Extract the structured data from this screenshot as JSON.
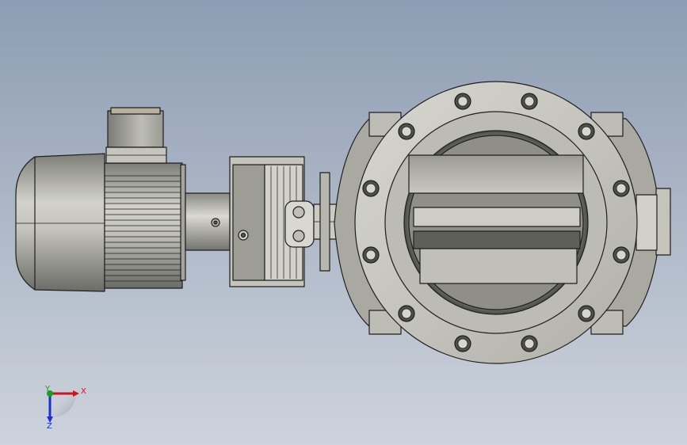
{
  "viewport": {
    "background_top": "#8e9db3",
    "background_bottom": "#cdd3dc",
    "model_name": "rotary-valve-with-gear-motor"
  },
  "colors": {
    "metal_light": "#c9c9c2",
    "metal_mid": "#a9a9a1",
    "metal_dark": "#5a5a55",
    "edge": "#1e1e1e",
    "axis_x": "#d0141e",
    "axis_y": "#18a020",
    "axis_z": "#1c2fd0"
  },
  "triad": {
    "x_label": "X",
    "y_label": "Y",
    "z_label": "Z",
    "icon": "coordinate-triad-icon"
  }
}
